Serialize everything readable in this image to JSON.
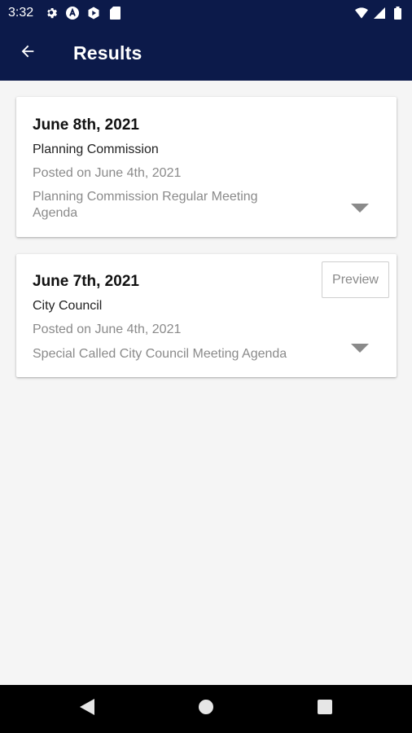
{
  "status_bar": {
    "time": "3:32",
    "left_icons": [
      "settings-icon",
      "at-icon",
      "play-icon",
      "sd-card-icon"
    ],
    "right_icons": [
      "wifi-icon",
      "signal-icon",
      "battery-icon"
    ]
  },
  "app_bar": {
    "title": "Results",
    "back_icon": "arrow-back-icon",
    "background": "#0c1a4a"
  },
  "results": [
    {
      "date": "June 8th, 2021",
      "body": "Planning Commission",
      "posted": "Posted on June 4th, 2021",
      "description": "Planning Commission Regular Meeting Agenda",
      "has_preview": false
    },
    {
      "date": "June 7th, 2021",
      "body": "City Council",
      "posted": "Posted on June 4th, 2021",
      "description": "Special Called City Council Meeting Agenda",
      "has_preview": true,
      "preview_label": "Preview"
    }
  ],
  "nav_bar": {
    "buttons": [
      "back-triangle-icon",
      "home-circle-icon",
      "recents-square-icon"
    ]
  }
}
